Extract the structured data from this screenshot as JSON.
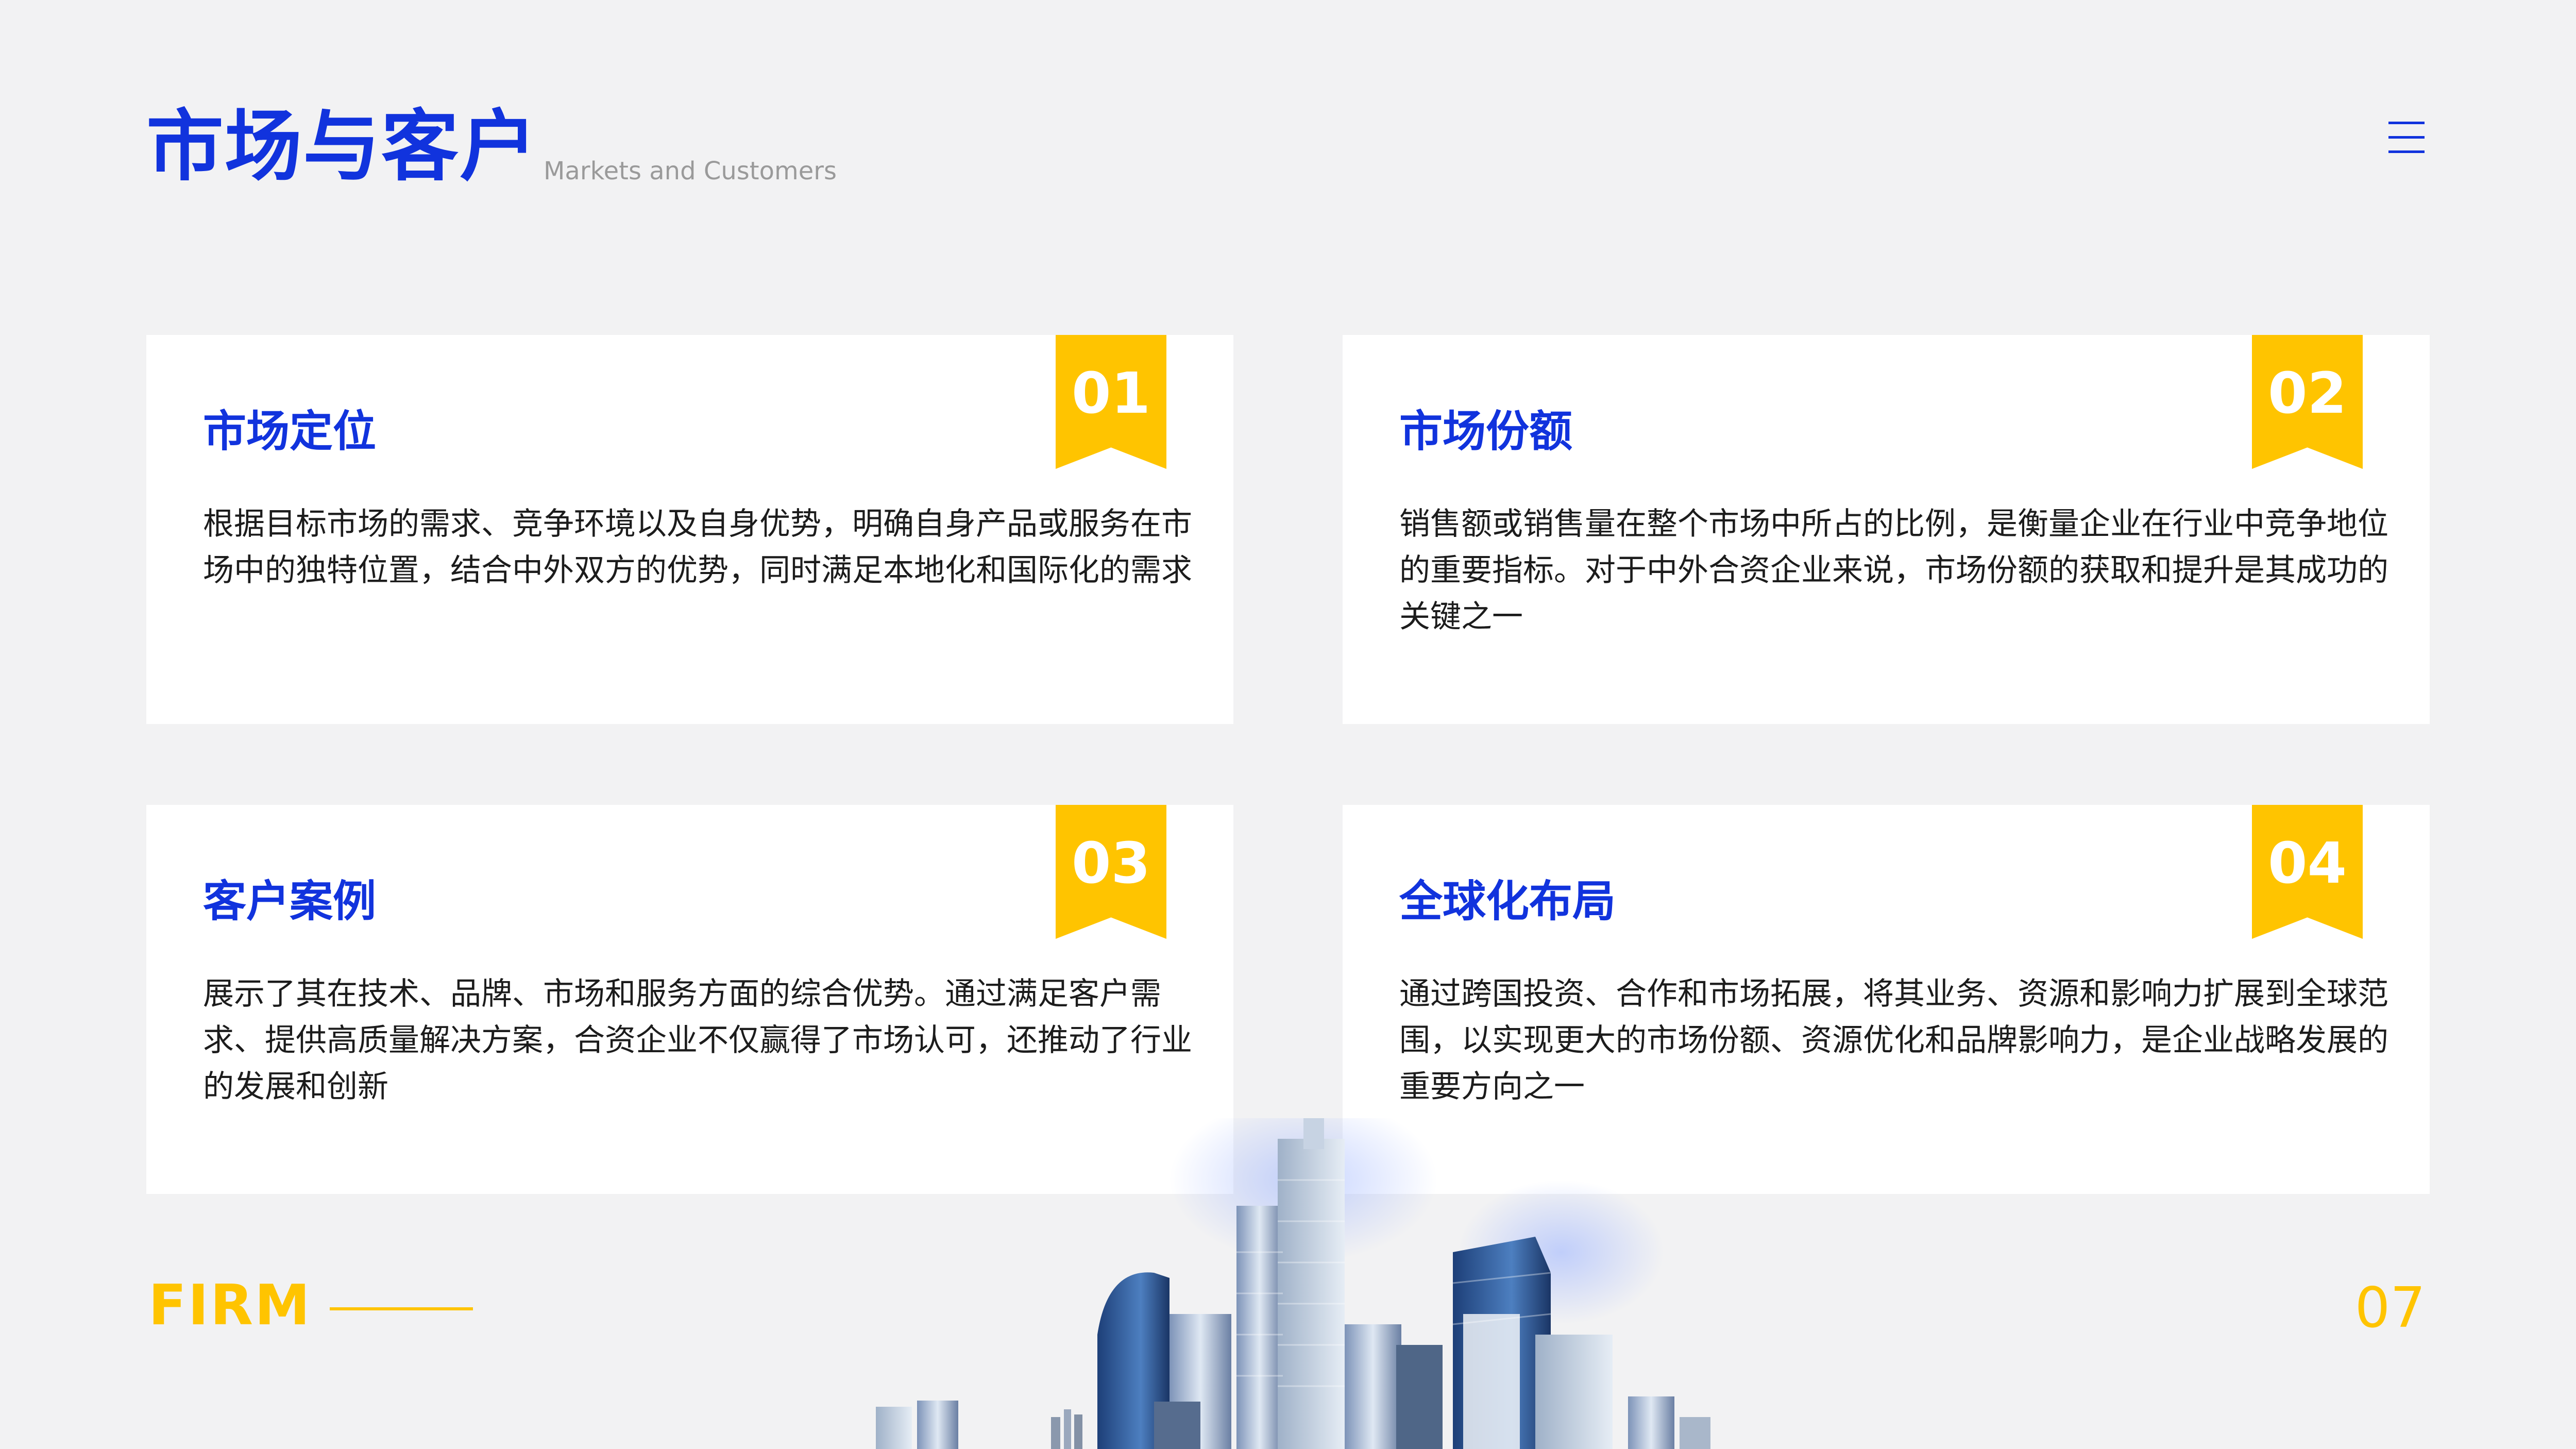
{
  "header": {
    "title": "市场与客户",
    "subtitle": "Markets and Customers"
  },
  "cards": [
    {
      "number": "01",
      "title": "市场定位",
      "body": "根据目标市场的需求、竞争环境以及自身优势，明确自身产品或服务在市场中的独特位置，结合中外双方的优势，同时满足本地化和国际化的需求"
    },
    {
      "number": "02",
      "title": "市场份额",
      "body": "销售额或销售量在整个市场中所占的比例，是衡量企业在行业中竞争地位的重要指标。对于中外合资企业来说，市场份额的获取和提升是其成功的关键之一"
    },
    {
      "number": "03",
      "title": "客户案例",
      "body": "展示了其在技术、品牌、市场和服务方面的综合优势。通过满足客户需求、提供高质量解决方案，合资企业不仅赢得了市场认可，还推动了行业的发展和创新"
    },
    {
      "number": "04",
      "title": "全球化布局",
      "body": "通过跨国投资、合作和市场拓展，将其业务、资源和影响力扩展到全球范围，以实现更大的市场份额、资源优化和品牌影响力，是企业战略发展的重要方向之一"
    }
  ],
  "footer": {
    "brand": "FIRM",
    "page_number": "07"
  },
  "colors": {
    "accent_blue": "#1133dd",
    "accent_yellow": "#ffc400",
    "background": "#f2f2f3"
  },
  "icons": {
    "menu": "hamburger-menu-icon",
    "illustration": "city-skyline-image"
  }
}
